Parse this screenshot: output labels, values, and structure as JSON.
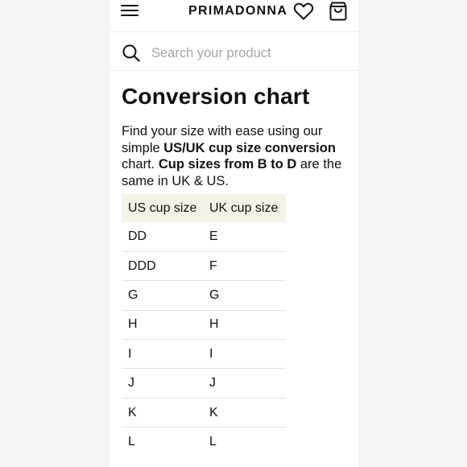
{
  "header": {
    "brand": "PRIMADONNA",
    "menu_icon": "hamburger-menu-icon",
    "wishlist_icon": "heart-icon",
    "cart_icon": "shopping-bag-icon"
  },
  "search": {
    "placeholder": "Search your product",
    "icon": "search-icon"
  },
  "main": {
    "title": "Conversion chart",
    "intro": {
      "part1": "Find your size with ease using our simple ",
      "bold1": "US/UK cup size conversion",
      "part2": " chart. ",
      "bold2": "Cup sizes from B to D",
      "part3": " are the same in UK & US."
    },
    "table": {
      "headers": [
        "US cup size",
        "UK cup size"
      ],
      "rows": [
        [
          "DD",
          "E"
        ],
        [
          "DDD",
          "F"
        ],
        [
          "G",
          "G"
        ],
        [
          "H",
          "H"
        ],
        [
          "I",
          "I"
        ],
        [
          "J",
          "J"
        ],
        [
          "K",
          "K"
        ],
        [
          "L",
          "L"
        ]
      ]
    }
  },
  "colors": {
    "table_header_bg": "#f4f1e7",
    "text": "#111111",
    "placeholder": "#a3a3a3"
  }
}
